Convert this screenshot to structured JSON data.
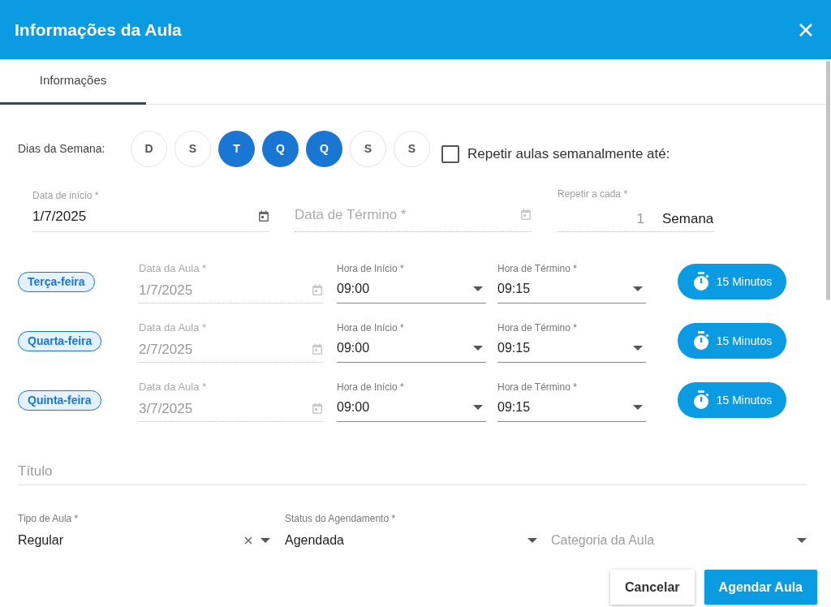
{
  "header": {
    "title": "Informações da Aula"
  },
  "tabs": [
    {
      "label": "Informações",
      "selected": true
    }
  ],
  "weekdays": {
    "label": "Dias da Semana:",
    "days": [
      {
        "letter": "D",
        "selected": false
      },
      {
        "letter": "S",
        "selected": false
      },
      {
        "letter": "T",
        "selected": true
      },
      {
        "letter": "Q",
        "selected": true
      },
      {
        "letter": "Q",
        "selected": true
      },
      {
        "letter": "S",
        "selected": false
      },
      {
        "letter": "S",
        "selected": false
      }
    ]
  },
  "repeat_weekly": {
    "label": "Repetir aulas semanalmente até:",
    "checked": false
  },
  "start_date": {
    "label": "Data de início *",
    "value": "1/7/2025",
    "disabled": false
  },
  "end_date": {
    "placeholder": "Data de Término *",
    "disabled": true
  },
  "repeat_every": {
    "label": "Repetir a cada *",
    "value": "1",
    "unit": "Semana",
    "disabled": true
  },
  "sessions": [
    {
      "day": "Terça-feira",
      "date_label": "Data da Aula *",
      "date": "1/7/2025",
      "date_disabled": true,
      "start_label": "Hora de Início *",
      "start": "09:00",
      "end_label": "Hora de Término *",
      "end": "09:15",
      "duration": "15 Minutos"
    },
    {
      "day": "Quarta-feira",
      "date_label": "Data da Aula *",
      "date": "2/7/2025",
      "date_disabled": true,
      "start_label": "Hora de Início *",
      "start": "09:00",
      "end_label": "Hora de Término *",
      "end": "09:15",
      "duration": "15 Minutos"
    },
    {
      "day": "Quinta-feira",
      "date_label": "Data da Aula *",
      "date": "3/7/2025",
      "date_disabled": true,
      "start_label": "Hora de Início *",
      "start": "09:00",
      "end_label": "Hora de Término *",
      "end": "09:15",
      "duration": "15 Minutos"
    }
  ],
  "title_field": {
    "placeholder": "Título"
  },
  "class_type": {
    "label": "Tipo de Aula *",
    "value": "Regular",
    "clearable": true
  },
  "status": {
    "label": "Status do Agendamento *",
    "value": "Agendada"
  },
  "category": {
    "placeholder": "Categoria da Aula"
  },
  "buttons": {
    "cancel": "Cancelar",
    "submit": "Agendar Aula"
  }
}
